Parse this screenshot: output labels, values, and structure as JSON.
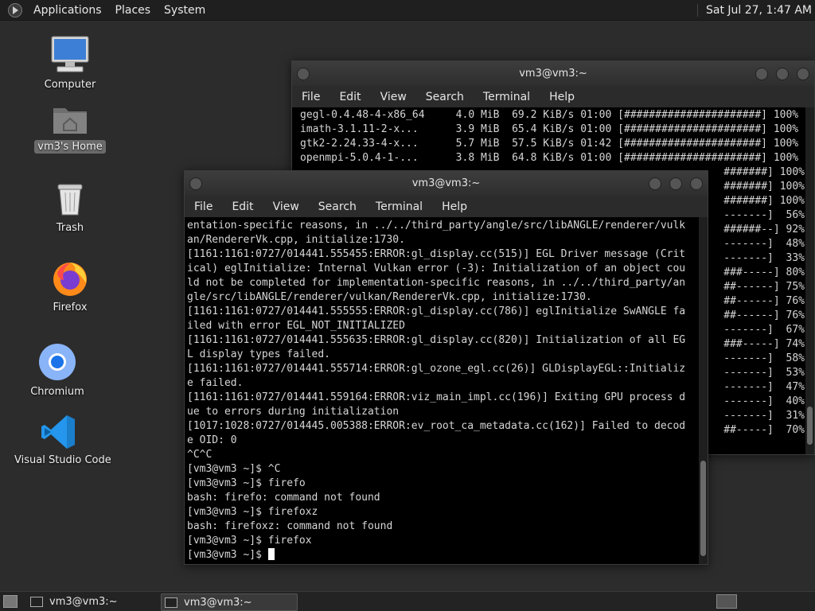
{
  "top_panel": {
    "menus": [
      "Applications",
      "Places",
      "System"
    ],
    "clock": "Sat Jul 27,  1:47 AM"
  },
  "desktop_icons": [
    {
      "label": "Computer",
      "icon": "computer-icon"
    },
    {
      "label": "vm3's Home",
      "icon": "home-folder-icon"
    },
    {
      "label": "Trash",
      "icon": "trash-icon"
    },
    {
      "label": "Firefox",
      "icon": "firefox-icon"
    },
    {
      "label": "Chromium",
      "icon": "chromium-icon"
    },
    {
      "label": "Visual Studio Code",
      "icon": "vscode-icon"
    }
  ],
  "back_window": {
    "title": "vm3@vm3:~",
    "menu": [
      "File",
      "Edit",
      "View",
      "Search",
      "Terminal",
      "Help"
    ],
    "rows": [
      "gegl-0.4.48-4-x86_64     4.0 MiB  69.2 KiB/s 01:00 [######################] 100%",
      "imath-3.1.11-2-x...      3.9 MiB  65.4 KiB/s 01:00 [######################] 100%",
      "gtk2-2.24.33-4-x...      5.7 MiB  57.5 KiB/s 01:42 [######################] 100%",
      "openmpi-5.0.4-1-...      3.8 MiB  64.8 KiB/s 01:00 [######################] 100%"
    ],
    "partial_rows": [
      "#######] 100%",
      "#######] 100%",
      "#######] 100%",
      "-------]  56%",
      "######--] 92%",
      "-------]  48%",
      "-------]  33%",
      "###-----] 80%",
      "##------] 75%",
      "##------] 76%",
      "##------] 76%",
      "-------]  67%",
      "###-----] 74%",
      "-------]  58%",
      "-------]  53%",
      "-------]  47%",
      "-------]  40%",
      "-------]  31%",
      "##-----]  70%"
    ]
  },
  "front_window": {
    "title": "vm3@vm3:~",
    "menu": [
      "File",
      "Edit",
      "View",
      "Search",
      "Terminal",
      "Help"
    ],
    "lines": [
      "entation-specific reasons, in ../../third_party/angle/src/libANGLE/renderer/vulk",
      "an/RendererVk.cpp, initialize:1730.",
      "[1161:1161:0727/014441.555455:ERROR:gl_display.cc(515)] EGL Driver message (Crit",
      "ical) eglInitialize: Internal Vulkan error (-3): Initialization of an object cou",
      "ld not be completed for implementation-specific reasons, in ../../third_party/an",
      "gle/src/libANGLE/renderer/vulkan/RendererVk.cpp, initialize:1730.",
      "[1161:1161:0727/014441.555555:ERROR:gl_display.cc(786)] eglInitialize SwANGLE fa",
      "iled with error EGL_NOT_INITIALIZED",
      "[1161:1161:0727/014441.555635:ERROR:gl_display.cc(820)] Initialization of all EG",
      "L display types failed.",
      "[1161:1161:0727/014441.555714:ERROR:gl_ozone_egl.cc(26)] GLDisplayEGL::Initializ",
      "e failed.",
      "[1161:1161:0727/014441.559164:ERROR:viz_main_impl.cc(196)] Exiting GPU process d",
      "ue to errors during initialization",
      "[1017:1028:0727/014445.005388:ERROR:ev_root_ca_metadata.cc(162)] Failed to decod",
      "e OID: 0",
      "^C^C",
      "[vm3@vm3 ~]$ ^C",
      "[vm3@vm3 ~]$ firefo",
      "bash: firefo: command not found",
      "[vm3@vm3 ~]$ firefoxz",
      "bash: firefoxz: command not found",
      "[vm3@vm3 ~]$ firefox"
    ],
    "prompt": "[vm3@vm3 ~]$ "
  },
  "taskbar": {
    "items": [
      {
        "label": "vm3@vm3:~",
        "icon": "terminal-icon"
      },
      {
        "label": "vm3@vm3:~",
        "icon": "terminal-icon"
      }
    ]
  }
}
